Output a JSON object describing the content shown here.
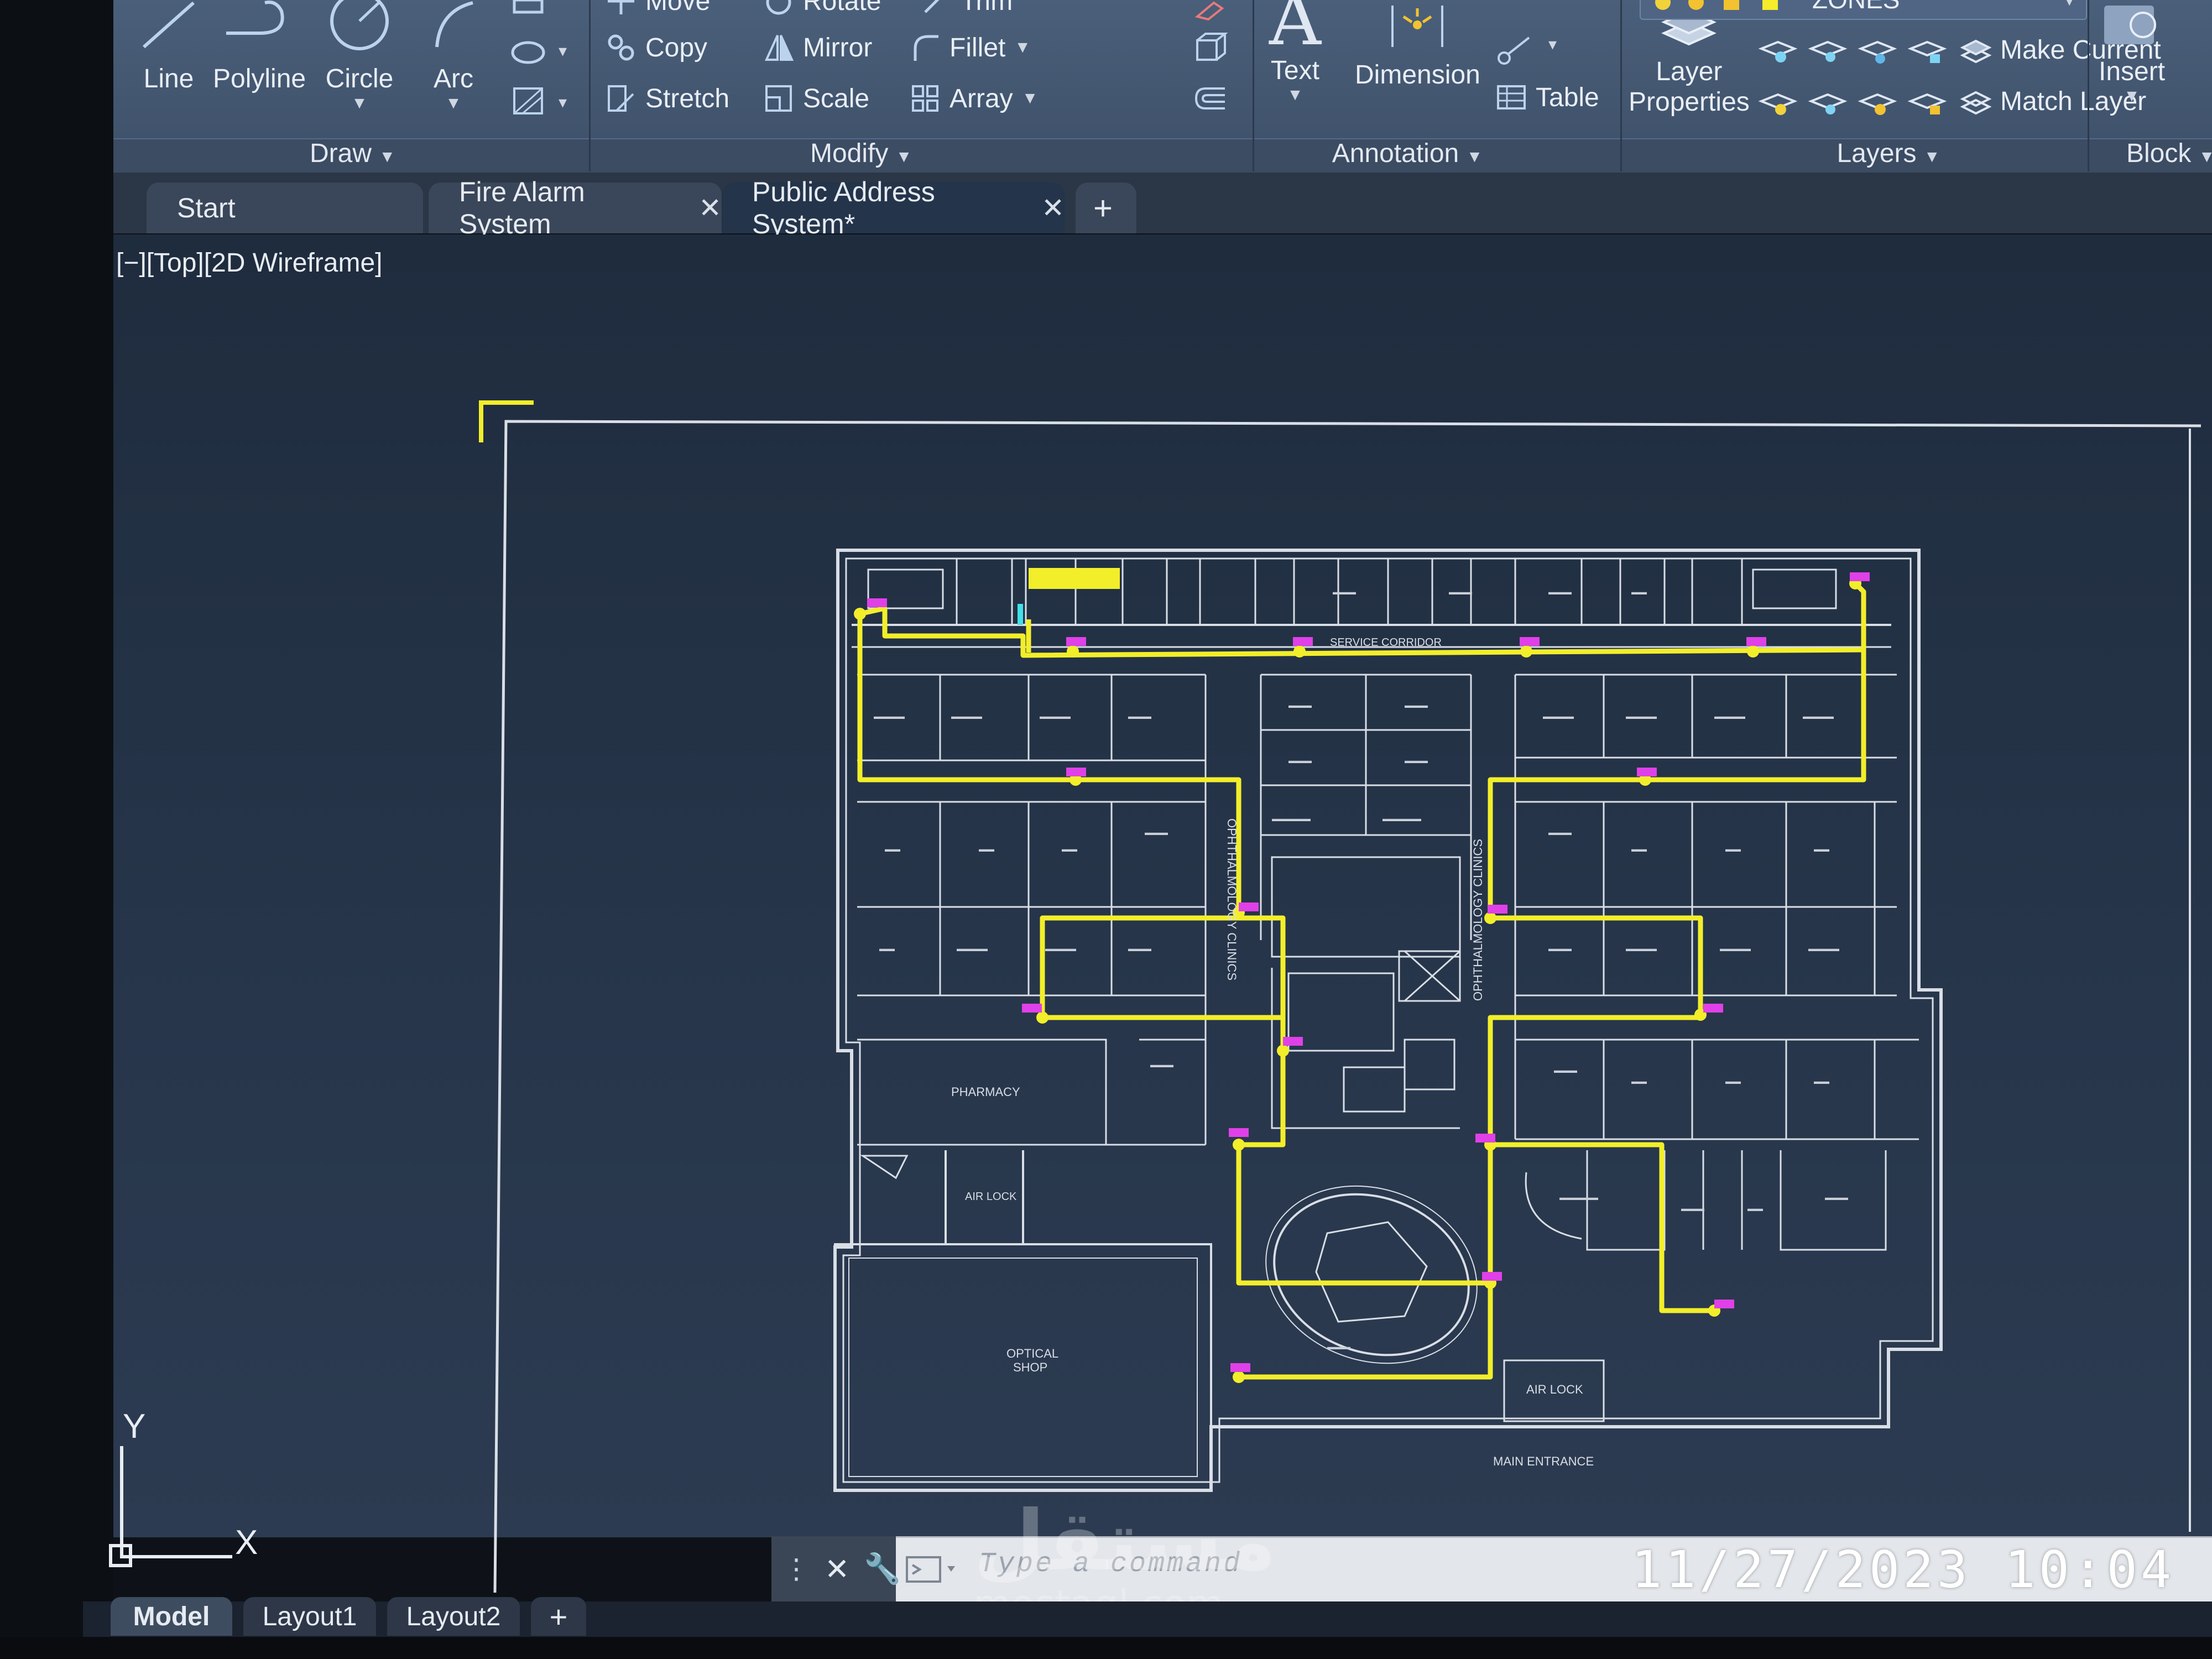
{
  "ribbon": {
    "draw": {
      "line": "Line",
      "polyline": "Polyline",
      "circle": "Circle",
      "arc": "Arc",
      "title": "Draw"
    },
    "modify": {
      "move": "Move",
      "rotate": "Rotate",
      "trim": "Trim",
      "copy": "Copy",
      "mirror": "Mirror",
      "fillet": "Fillet",
      "stretch": "Stretch",
      "scale": "Scale",
      "array": "Array",
      "title": "Modify"
    },
    "annotation": {
      "text": "Text",
      "dimension": "Dimension",
      "table": "Table",
      "title": "Annotation"
    },
    "layers": {
      "layer_properties_line1": "Layer",
      "layer_properties_line2": "Properties",
      "current_layer": "ZONES",
      "make_current": "Make Current",
      "match_layer": "Match Layer",
      "title": "Layers"
    },
    "block": {
      "insert": "Insert",
      "title": "Block"
    }
  },
  "file_tabs": [
    {
      "label": "Start"
    },
    {
      "label": "Fire Alarm System"
    },
    {
      "label": "Public Address System*"
    }
  ],
  "viewport_label": "[−][Top][2D Wireframe]",
  "plan": {
    "service_corridor": "SERVICE CORRIDOR",
    "clinics_left": "OPHTHALMOLOGY CLINICS",
    "clinics_right": "OPHTHALMOLOGY CLINICS",
    "pharmacy": "PHARMACY",
    "optical_shop_1": "OPTICAL",
    "optical_shop_2": "SHOP",
    "air_lock_1": "AIR LOCK",
    "air_lock_2": "AIR LOCK",
    "main_entrance": "MAIN ENTRANCE",
    "wire_color": "#f2ee2a",
    "speaker_color": "#e040e8",
    "line_color": "#d9dee6"
  },
  "ucs": {
    "y": "Y",
    "x": "X"
  },
  "command": {
    "placeholder": "Type a command"
  },
  "timestamp": "11/27/2023  10:04",
  "watermark": {
    "main": "مستقل",
    "sub": "mostaql.com"
  },
  "layout_tabs": [
    {
      "label": "Model"
    },
    {
      "label": "Layout1"
    },
    {
      "label": "Layout2"
    }
  ]
}
